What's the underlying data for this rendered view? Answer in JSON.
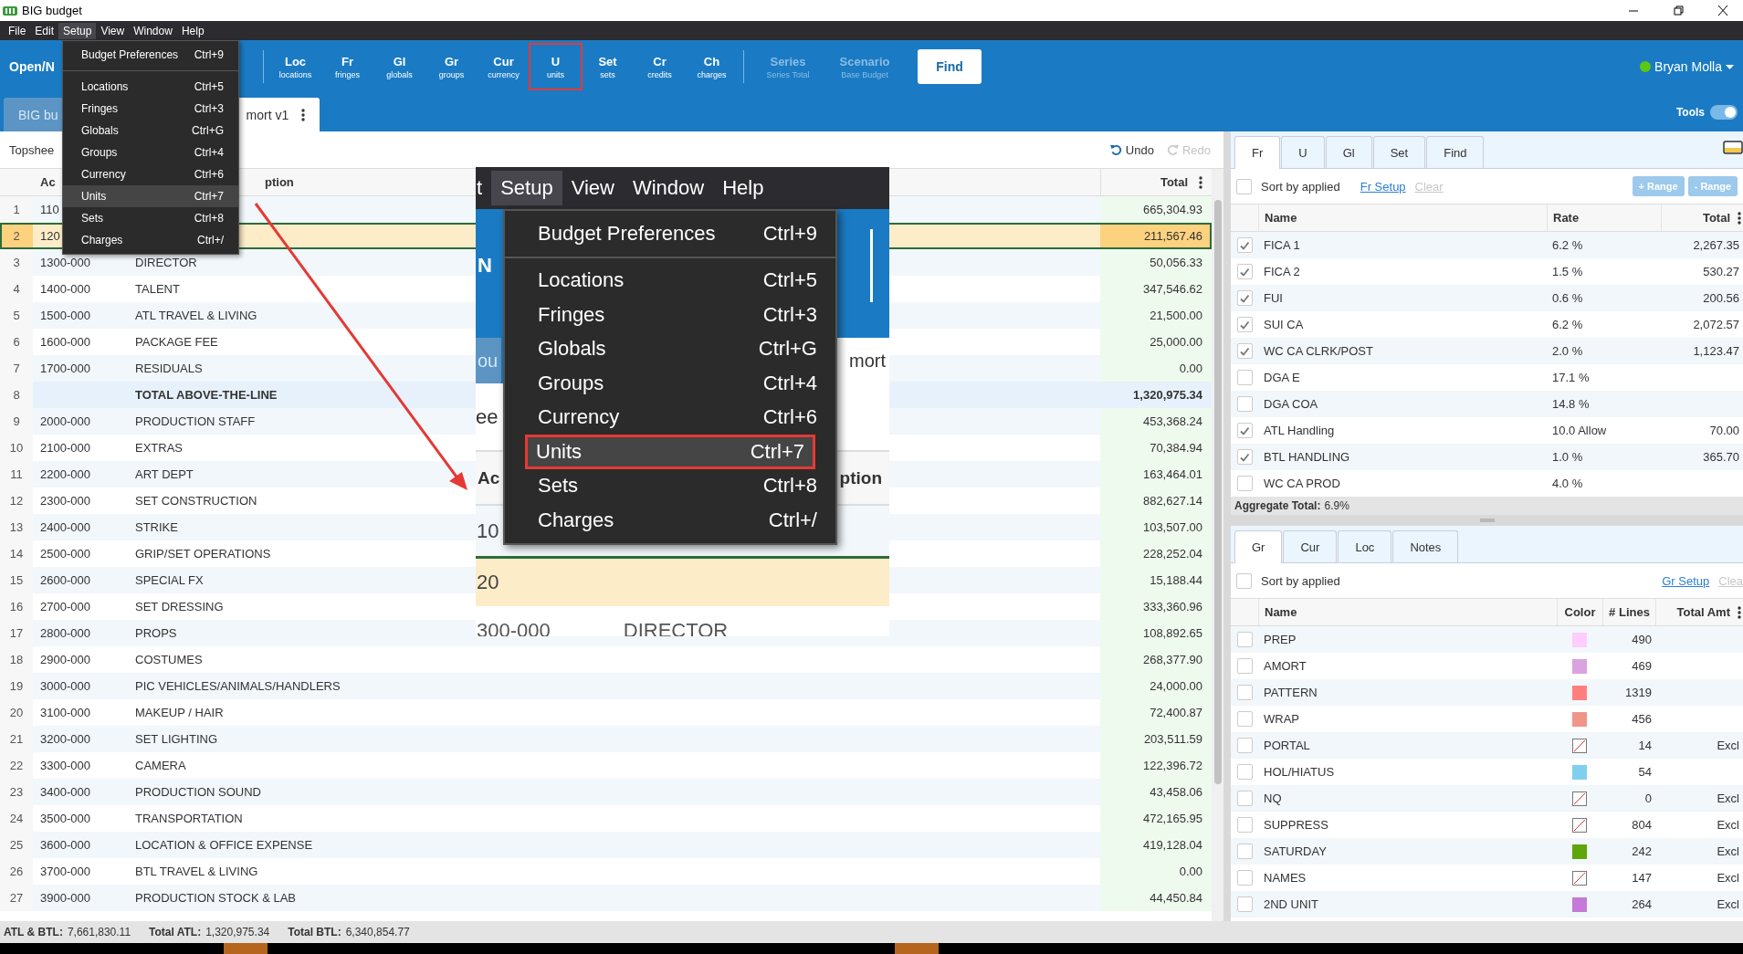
{
  "window": {
    "title": "BIG budget"
  },
  "menubar": [
    {
      "label": "File",
      "selected": false
    },
    {
      "label": "Edit",
      "selected": false
    },
    {
      "label": "Setup",
      "selected": true
    },
    {
      "label": "View",
      "selected": false
    },
    {
      "label": "Window",
      "selected": false
    },
    {
      "label": "Help",
      "selected": false
    }
  ],
  "setup_menu": [
    {
      "label": "Budget Preferences",
      "shortcut": "Ctrl+9",
      "separator_after": true,
      "selected": false
    },
    {
      "label": "Locations",
      "shortcut": "Ctrl+5",
      "separator_after": false,
      "selected": false
    },
    {
      "label": "Fringes",
      "shortcut": "Ctrl+3",
      "separator_after": false,
      "selected": false
    },
    {
      "label": "Globals",
      "shortcut": "Ctrl+G",
      "separator_after": false,
      "selected": false
    },
    {
      "label": "Groups",
      "shortcut": "Ctrl+4",
      "separator_after": false,
      "selected": false
    },
    {
      "label": "Currency",
      "shortcut": "Ctrl+6",
      "separator_after": false,
      "selected": false
    },
    {
      "label": "Units",
      "shortcut": "Ctrl+7",
      "separator_after": false,
      "selected": true
    },
    {
      "label": "Sets",
      "shortcut": "Ctrl+8",
      "separator_after": false,
      "selected": false
    },
    {
      "label": "Charges",
      "shortcut": "Ctrl+/",
      "separator_after": false,
      "selected": false
    }
  ],
  "toolbar": {
    "open_label": "Open/N",
    "buttons": [
      {
        "label": "Loc",
        "sublabel": "locations",
        "disabled": false,
        "callout": false
      },
      {
        "label": "Fr",
        "sublabel": "fringes",
        "disabled": false,
        "callout": false
      },
      {
        "label": "Gl",
        "sublabel": "globals",
        "disabled": false,
        "callout": false
      },
      {
        "label": "Gr",
        "sublabel": "groups",
        "disabled": false,
        "callout": false
      },
      {
        "label": "Cur",
        "sublabel": "currency",
        "disabled": false,
        "callout": false
      },
      {
        "label": "U",
        "sublabel": "units",
        "disabled": false,
        "callout": true
      },
      {
        "label": "Set",
        "sublabel": "sets",
        "disabled": false,
        "callout": false
      },
      {
        "label": "Cr",
        "sublabel": "credits",
        "disabled": false,
        "callout": false
      },
      {
        "label": "Ch",
        "sublabel": "charges",
        "disabled": false,
        "callout": false
      }
    ],
    "scenario_buttons": [
      {
        "label": "Series",
        "sublabel": "Series Total",
        "disabled": true,
        "callout": false
      },
      {
        "label": "Scenario",
        "sublabel": "Base Budget",
        "disabled": true,
        "callout": false
      }
    ],
    "find_label": "Find",
    "user": {
      "name": "Bryan Molla",
      "online": true
    },
    "tools": {
      "label": "Tools",
      "on": true
    }
  },
  "doc_tabs": [
    {
      "label": "BIG bu",
      "selected": false
    },
    {
      "label": "mort v1",
      "selected": true
    }
  ],
  "breadcrumb": "Topshee",
  "undo": {
    "label": "Undo",
    "disabled": false
  },
  "redo": {
    "label": "Redo",
    "disabled": true
  },
  "table": {
    "columns": [
      "Ac",
      "ption",
      "Total"
    ],
    "rows": [
      {
        "num": "1",
        "account": "110",
        "total": "665,304.93",
        "kind": "line",
        "selected": false
      },
      {
        "num": "2",
        "account": "120",
        "total": "211,567.46",
        "kind": "line",
        "selected": true
      },
      {
        "num": "3",
        "account": "1300-000",
        "description": "DIRECTOR",
        "total": "50,056.33",
        "kind": "line",
        "selected": false
      },
      {
        "num": "4",
        "account": "1400-000",
        "description": "TALENT",
        "total": "347,546.62",
        "kind": "line",
        "selected": false
      },
      {
        "num": "5",
        "account": "1500-000",
        "description": "ATL TRAVEL & LIVING",
        "total": "21,500.00",
        "kind": "line",
        "selected": false
      },
      {
        "num": "6",
        "account": "1600-000",
        "description": "PACKAGE FEE",
        "total": "25,000.00",
        "kind": "line",
        "selected": false
      },
      {
        "num": "7",
        "account": "1700-000",
        "description": "RESIDUALS",
        "total": "0.00",
        "kind": "line",
        "selected": false
      },
      {
        "num": "8",
        "description": "TOTAL ABOVE-THE-LINE",
        "total": "1,320,975.34",
        "kind": "total",
        "selected": false
      },
      {
        "num": "9",
        "account": "2000-000",
        "description": "PRODUCTION STAFF",
        "total": "453,368.24",
        "kind": "line",
        "selected": false
      },
      {
        "num": "10",
        "account": "2100-000",
        "description": "EXTRAS",
        "total": "70,384.94",
        "kind": "line",
        "selected": false
      },
      {
        "num": "11",
        "account": "2200-000",
        "description": "ART DEPT",
        "total": "163,464.01",
        "kind": "line",
        "selected": false
      },
      {
        "num": "12",
        "account": "2300-000",
        "description": "SET CONSTRUCTION",
        "total": "882,627.14",
        "kind": "line",
        "selected": false
      },
      {
        "num": "13",
        "account": "2400-000",
        "description": "STRIKE",
        "total": "103,507.00",
        "kind": "line",
        "selected": false
      },
      {
        "num": "14",
        "account": "2500-000",
        "description": "GRIP/SET OPERATIONS",
        "total": "228,252.04",
        "kind": "line",
        "selected": false
      },
      {
        "num": "15",
        "account": "2600-000",
        "description": "SPECIAL FX",
        "total": "15,188.44",
        "kind": "line",
        "selected": false
      },
      {
        "num": "16",
        "account": "2700-000",
        "description": "SET DRESSING",
        "total": "333,360.96",
        "kind": "line",
        "selected": false
      },
      {
        "num": "17",
        "account": "2800-000",
        "description": "PROPS",
        "total": "108,892.65",
        "kind": "line",
        "selected": false
      },
      {
        "num": "18",
        "account": "2900-000",
        "description": "COSTUMES",
        "total": "268,377.90",
        "kind": "line",
        "selected": false
      },
      {
        "num": "19",
        "account": "3000-000",
        "description": "PIC VEHICLES/ANIMALS/HANDLERS",
        "total": "24,000.00",
        "kind": "line",
        "selected": false
      },
      {
        "num": "20",
        "account": "3100-000",
        "description": "MAKEUP / HAIR",
        "total": "72,400.87",
        "kind": "line",
        "selected": false
      },
      {
        "num": "21",
        "account": "3200-000",
        "description": "SET LIGHTING",
        "total": "203,511.59",
        "kind": "line",
        "selected": false
      },
      {
        "num": "22",
        "account": "3300-000",
        "description": "CAMERA",
        "total": "122,396.72",
        "kind": "line",
        "selected": false
      },
      {
        "num": "23",
        "account": "3400-000",
        "description": "PRODUCTION SOUND",
        "total": "43,458.06",
        "kind": "line",
        "selected": false
      },
      {
        "num": "24",
        "account": "3500-000",
        "description": "TRANSPORTATION",
        "total": "472,165.95",
        "kind": "line",
        "selected": false
      },
      {
        "num": "25",
        "account": "3600-000",
        "description": "LOCATION & OFFICE EXPENSE",
        "total": "419,128.04",
        "kind": "line",
        "selected": false
      },
      {
        "num": "26",
        "account": "3700-000",
        "description": "BTL TRAVEL & LIVING",
        "total": "0.00",
        "kind": "line",
        "selected": false
      },
      {
        "num": "27",
        "account": "3900-000",
        "description": "PRODUCTION STOCK & LAB",
        "total": "44,450.84",
        "kind": "line",
        "selected": false
      }
    ]
  },
  "fringe_panel": {
    "tabs": [
      {
        "label": "Fr",
        "selected": true
      },
      {
        "label": "U",
        "selected": false
      },
      {
        "label": "Gl",
        "selected": false
      },
      {
        "label": "Set",
        "selected": false
      },
      {
        "label": "Find",
        "selected": false
      }
    ],
    "sort_label": "Sort by applied",
    "sort_checked": false,
    "setup_link": "Fr Setup",
    "clear_link": {
      "label": "Clear",
      "disabled": true
    },
    "range_buttons": [
      {
        "label": "+ Range",
        "disabled": true
      },
      {
        "label": "- Range",
        "disabled": true
      }
    ],
    "columns": [
      "Name",
      "Rate",
      "Total"
    ],
    "rows": [
      {
        "checked": true,
        "name": "FICA 1",
        "rate": "6.2 %",
        "total": "2,267.35"
      },
      {
        "checked": true,
        "name": "FICA 2",
        "rate": "1.5 %",
        "total": "530.27"
      },
      {
        "checked": true,
        "name": "FUI",
        "rate": "0.6 %",
        "total": "200.56"
      },
      {
        "checked": true,
        "name": "SUI CA",
        "rate": "6.2 %",
        "total": "2,072.57"
      },
      {
        "checked": true,
        "name": "WC CA CLRK/POST",
        "rate": "2.0 %",
        "total": "1,123.47"
      },
      {
        "checked": false,
        "name": "DGA E",
        "rate": "17.1 %"
      },
      {
        "checked": false,
        "name": "DGA COA",
        "rate": "14.8 %"
      },
      {
        "checked": true,
        "name": "ATL Handling",
        "rate": "10.0 Allow",
        "total": "70.00"
      },
      {
        "checked": true,
        "name": "BTL HANDLING",
        "rate": "1.0 %",
        "total": "365.70"
      },
      {
        "checked": false,
        "name": "WC CA PROD",
        "rate": "4.0 %"
      }
    ],
    "aggregate_label": "Aggregate Total:",
    "aggregate_value": "6.9%"
  },
  "group_panel": {
    "tabs": [
      {
        "label": "Gr",
        "selected": true
      },
      {
        "label": "Cur",
        "selected": false
      },
      {
        "label": "Loc",
        "selected": false
      },
      {
        "label": "Notes",
        "selected": false
      }
    ],
    "sort_label": "Sort by applied",
    "sort_checked": false,
    "setup_link": "Gr Setup",
    "clear_link": {
      "label": "Clea",
      "disabled": true
    },
    "columns": [
      "Name",
      "Color",
      "# Lines",
      "Total Amt"
    ],
    "rows": [
      {
        "checked": false,
        "name": "PREP",
        "color": "#ffccff",
        "lines": "490"
      },
      {
        "checked": false,
        "name": "AMORT",
        "color": "#d9a3e0",
        "lines": "469"
      },
      {
        "checked": false,
        "name": "PATTERN",
        "color": "#ff7f7f",
        "lines": "1319"
      },
      {
        "checked": false,
        "name": "WRAP",
        "color": "#f0958a",
        "lines": "456"
      },
      {
        "checked": false,
        "name": "PORTAL",
        "lines": "14",
        "total": "Excl"
      },
      {
        "checked": false,
        "name": "HOL/HIATUS",
        "color": "#7fd0ee",
        "lines": "54"
      },
      {
        "checked": false,
        "name": "NQ",
        "lines": "0",
        "total": "Excl"
      },
      {
        "checked": false,
        "name": "SUPPRESS",
        "lines": "804",
        "total": "Excl"
      },
      {
        "checked": false,
        "name": "SATURDAY",
        "color": "#5ea60a",
        "lines": "242",
        "total": "Excl"
      },
      {
        "checked": false,
        "name": "NAMES",
        "lines": "147",
        "total": "Excl"
      },
      {
        "checked": false,
        "name": "2ND UNIT",
        "color": "#c47ad6",
        "lines": "264",
        "total": "Excl"
      }
    ]
  },
  "status_bar": [
    {
      "label": "ATL & BTL:",
      "value": "7,661,830.11"
    },
    {
      "label": "Total ATL:",
      "value": "1,320,975.34"
    },
    {
      "label": "Total BTL:",
      "value": "6,340,854.77"
    }
  ],
  "inset": {
    "menubar": [
      {
        "label": "t",
        "selected": false
      },
      {
        "label": "Setup",
        "selected": true
      },
      {
        "label": "View",
        "selected": false
      },
      {
        "label": "Window",
        "selected": false
      },
      {
        "label": "Help",
        "selected": false
      }
    ],
    "toolbar_fragment": "N",
    "tab_fragments": [
      "ou",
      "mort"
    ],
    "breadcrumb_fragment": "ee",
    "header_fragments": [
      "Ac",
      "ption"
    ],
    "rows": [
      {
        "account": "10",
        "selected": false
      },
      {
        "account": "20",
        "selected": true
      },
      {
        "account": "300-000",
        "description": "DIRECTOR",
        "selected": false
      }
    ],
    "menu": [
      {
        "label": "Budget Preferences",
        "shortcut": "Ctrl+9",
        "separator_after": true,
        "callout": false
      },
      {
        "label": "Locations",
        "shortcut": "Ctrl+5",
        "separator_after": false,
        "callout": false
      },
      {
        "label": "Fringes",
        "shortcut": "Ctrl+3",
        "separator_after": false,
        "callout": false
      },
      {
        "label": "Globals",
        "shortcut": "Ctrl+G",
        "separator_after": false,
        "callout": false
      },
      {
        "label": "Groups",
        "shortcut": "Ctrl+4",
        "separator_after": false,
        "callout": false
      },
      {
        "label": "Currency",
        "shortcut": "Ctrl+6",
        "separator_after": false,
        "callout": false
      },
      {
        "label": "Units",
        "shortcut": "Ctrl+7",
        "separator_after": false,
        "callout": true
      },
      {
        "label": "Sets",
        "shortcut": "Ctrl+8",
        "separator_after": false,
        "callout": false
      },
      {
        "label": "Charges",
        "shortcut": "Ctrl+/",
        "separator_after": false,
        "callout": false
      }
    ]
  }
}
